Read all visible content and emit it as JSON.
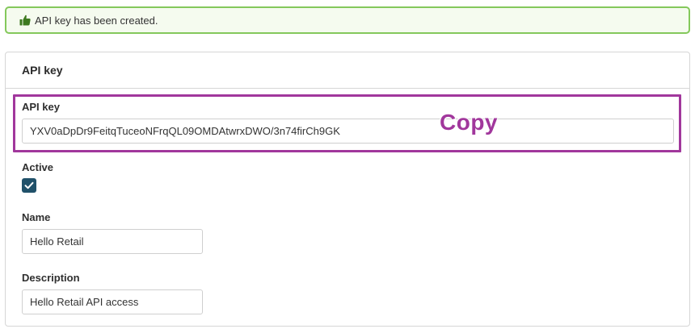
{
  "alert": {
    "message": "API key has been created.",
    "icon": "thumbs-up-icon",
    "color": "#84c85b"
  },
  "card": {
    "title": "API key"
  },
  "form": {
    "api_key": {
      "label": "API key",
      "value": "YXV0aDpDr9FeitqTuceoNFrqQL09OMDAtwrxDWO/3n74firCh9GK"
    },
    "active": {
      "label": "Active",
      "checked": true
    },
    "name": {
      "label": "Name",
      "value": "Hello Retail"
    },
    "description": {
      "label": "Description",
      "value": "Hello Retail API access"
    }
  },
  "annotation": {
    "text": "Copy",
    "color": "#a1379c"
  }
}
